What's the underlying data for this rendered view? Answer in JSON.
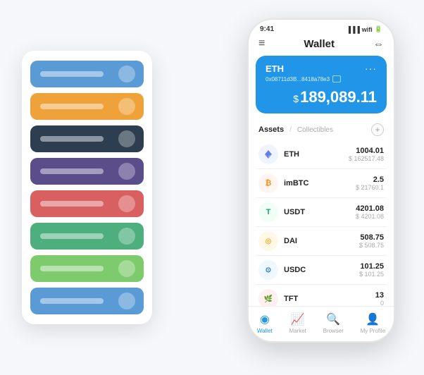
{
  "scene": {
    "card_stack": {
      "items": [
        {
          "color": "card-blue",
          "label": ""
        },
        {
          "color": "card-orange",
          "label": ""
        },
        {
          "color": "card-dark",
          "label": ""
        },
        {
          "color": "card-purple",
          "label": ""
        },
        {
          "color": "card-red",
          "label": ""
        },
        {
          "color": "card-green",
          "label": ""
        },
        {
          "color": "card-lightgreen",
          "label": ""
        },
        {
          "color": "card-skyblue",
          "label": ""
        }
      ]
    },
    "phone": {
      "status_bar": {
        "time": "9:41",
        "signal": "●●●",
        "wifi": "▲",
        "battery": "▐"
      },
      "header": {
        "menu_icon": "≡",
        "title": "Wallet",
        "scan_icon": "⊡"
      },
      "wallet_card": {
        "coin": "ETH",
        "address": "0x08711d3B...8418a78e3",
        "copy_icon": "⧉",
        "more_icon": "...",
        "balance_symbol": "$",
        "balance": "189,089.11"
      },
      "assets": {
        "tab_active": "Assets",
        "tab_separator": "/",
        "tab_inactive": "Collectibles",
        "add_icon": "+",
        "list": [
          {
            "name": "ETH",
            "icon_type": "eth-icon",
            "icon_char": "♦",
            "amount": "1004.01",
            "usd": "$ 162517.48"
          },
          {
            "name": "imBTC",
            "icon_type": "imbtc-icon",
            "icon_char": "₿",
            "amount": "2.5",
            "usd": "$ 21760.1"
          },
          {
            "name": "USDT",
            "icon_type": "usdt-icon",
            "icon_char": "T",
            "amount": "4201.08",
            "usd": "$ 4201.08"
          },
          {
            "name": "DAI",
            "icon_type": "dai-icon",
            "icon_char": "◎",
            "amount": "508.75",
            "usd": "$ 508.75"
          },
          {
            "name": "USDC",
            "icon_type": "usdc-icon",
            "icon_char": "⊙",
            "amount": "101.25",
            "usd": "$ 101.25"
          },
          {
            "name": "TFT",
            "icon_type": "tft-icon",
            "icon_char": "🌿",
            "amount": "13",
            "usd": "0"
          }
        ]
      },
      "bottom_nav": [
        {
          "label": "Wallet",
          "icon": "◉",
          "active": true
        },
        {
          "label": "Market",
          "icon": "📊",
          "active": false
        },
        {
          "label": "Browser",
          "icon": "🌐",
          "active": false
        },
        {
          "label": "My Profile",
          "icon": "👤",
          "active": false
        }
      ]
    }
  }
}
